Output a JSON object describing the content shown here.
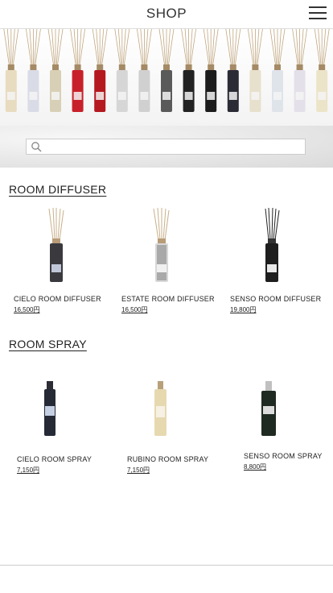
{
  "header": {
    "title": "SHOP"
  },
  "search": {
    "placeholder": ""
  },
  "sections": [
    {
      "title": "ROOM DIFFUSER",
      "products": [
        {
          "name": "CIELO ROOM DIFFUSER",
          "price": "16,500円"
        },
        {
          "name": "ESTATE ROOM DIFFUSER",
          "price": "16,500円"
        },
        {
          "name": "SENSO ROOM DIFFUSER",
          "price": "19,800円"
        }
      ]
    },
    {
      "title": "ROOM SPRAY",
      "products": [
        {
          "name": "CIELO ROOM SPRAY",
          "price": "7,150円"
        },
        {
          "name": "RUBINO ROOM SPRAY",
          "price": "7,150円"
        },
        {
          "name": "SENSO ROOM SPRAY",
          "price": "8,800円"
        }
      ]
    }
  ],
  "icons": {
    "menu": "hamburger-menu-icon",
    "search": "search-icon"
  },
  "colors": {
    "text": "#222222",
    "divider": "#cccccc"
  }
}
